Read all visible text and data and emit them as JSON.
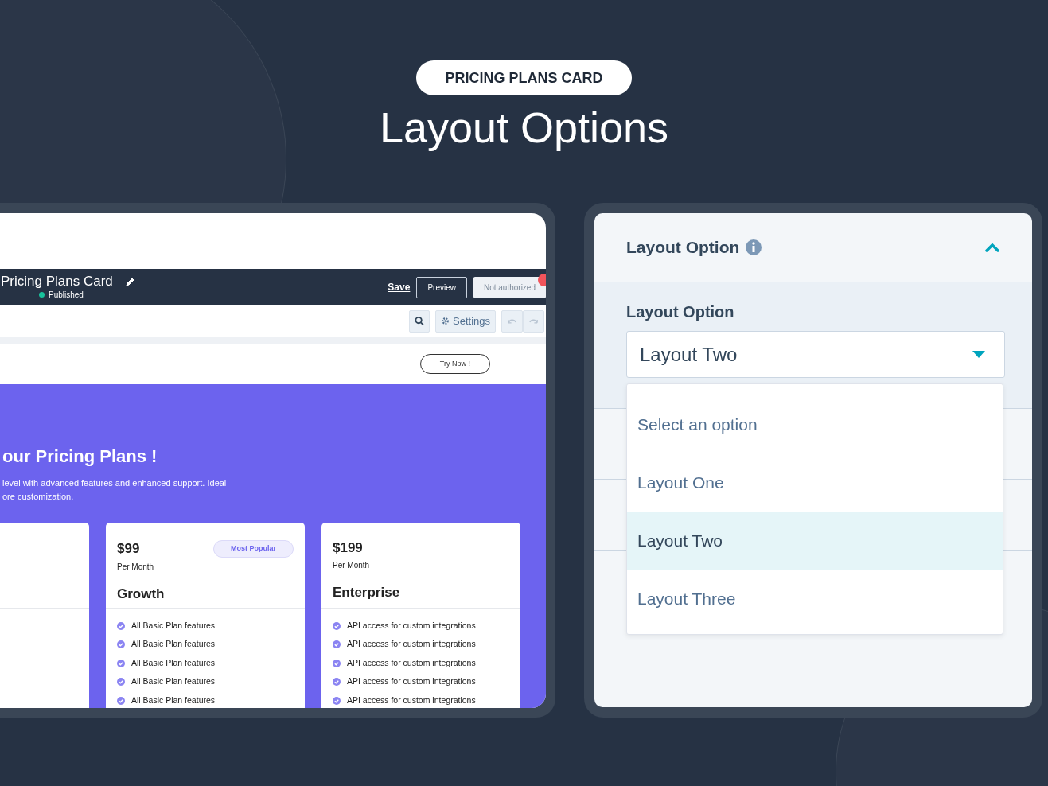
{
  "heading": {
    "pill": "PRICING PLANS CARD",
    "title": "Layout Options"
  },
  "editor": {
    "title": "Pricing Plans Card",
    "status": "Published",
    "save": "Save",
    "preview": "Preview",
    "publish": "Not authorized",
    "settings": "Settings",
    "try_now": "Try Now !",
    "banner_title": "our Pricing Plans !",
    "description_lines": [
      "level with advanced features and enhanced support. Ideal",
      "ore customization."
    ],
    "plans": [
      {
        "price": "$99",
        "period": "Per Month",
        "name": "Growth",
        "badge": "Most Popular",
        "features": [
          "All Basic Plan features",
          "All Basic Plan features",
          "All Basic Plan features",
          "All Basic Plan features",
          "All Basic Plan features"
        ]
      },
      {
        "price": "$199",
        "period": "Per Month",
        "name": "Enterprise",
        "features": [
          "API access for custom integrations",
          "API access for custom integrations",
          "API access for custom integrations",
          "API access for custom integrations",
          "API access for custom integrations"
        ]
      }
    ]
  },
  "settings_panel": {
    "section_title": "Layout Option",
    "expanded": true,
    "field_label": "Layout Option",
    "value": "Layout Two",
    "options": [
      {
        "label": "Select an option",
        "selected": false
      },
      {
        "label": "Layout One",
        "selected": false
      },
      {
        "label": "Layout Two",
        "selected": true
      },
      {
        "label": "Layout Three",
        "selected": false
      }
    ]
  }
}
